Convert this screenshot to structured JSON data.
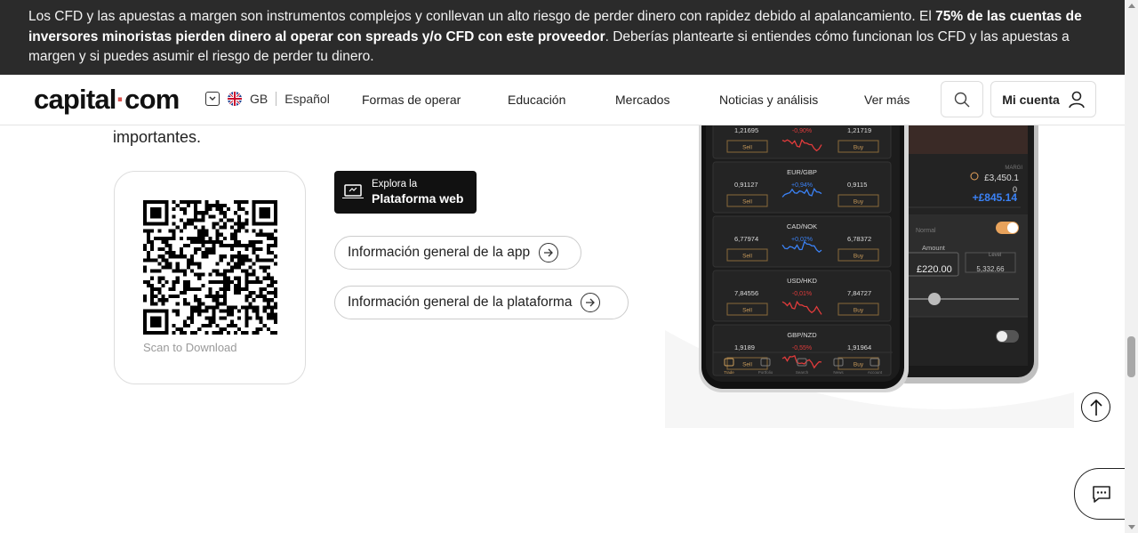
{
  "risk_banner": {
    "part1": "Los CFD y las apuestas a margen son instrumentos complejos y conllevan un alto riesgo de perder dinero con rapidez debido al apalancamiento. El ",
    "bold": "75% de las cuentas de inversores minoristas pierden dinero al operar con spreads y/o CFD con este proveedor",
    "part2": ". Deberías plantearte si entiendes cómo funcionan los CFD y las apuestas a margen y si puedes asumir el riesgo de perder tu dinero."
  },
  "header": {
    "logo_left": "capital",
    "logo_dot": "·",
    "logo_right": "com",
    "region": "GB",
    "language": "Español",
    "nav": [
      "Formas de operar",
      "Educación",
      "Mercados",
      "Noticias y análisis",
      "Ver más"
    ],
    "account_label": "Mi cuenta"
  },
  "main": {
    "intro_tail": "importantes.",
    "qr_caption": "Scan to Download",
    "web_button": {
      "line1": "Explora la",
      "line2": "Plataforma web"
    },
    "links": [
      "Información general de la app",
      "Información general de la plataforma"
    ]
  },
  "phone_app": {
    "markets": [
      {
        "pair": "",
        "sell": "1,21695",
        "change": "-0,90%",
        "buy": "1,21719"
      },
      {
        "pair": "EUR/GBP",
        "sell": "0,91127",
        "change": "+0,94%",
        "buy": "0,9115"
      },
      {
        "pair": "CAD/NOK",
        "sell": "6,77974",
        "change": "+0,02%",
        "buy": "6,78372"
      },
      {
        "pair": "USD/HKD",
        "sell": "7,84556",
        "change": "-0,01%",
        "buy": "7,84727"
      },
      {
        "pair": "GBP/NZD",
        "sell": "1,9189",
        "change": "-0,55%",
        "buy": "1,91964"
      }
    ],
    "sell_label": "Sell",
    "buy_label": "Buy",
    "tabs": [
      "Trade",
      "Portfolio",
      "Search",
      "News",
      "Account"
    ],
    "trade_panel": {
      "margin_label": "MARGI",
      "margin_value": "£3,450.1",
      "zero": "0",
      "pnl": "+£845.14",
      "mode": "Normal",
      "amount_label": "Amount",
      "amount_value": "£220.00",
      "level_label": "Level",
      "level_value": "5,332.66"
    }
  },
  "colors": {
    "banner_bg": "#2b2b2b",
    "positive": "#3b82f6",
    "negative": "#e03b3b",
    "toggle": "#e8a35c"
  },
  "icons": {
    "search": "search-icon",
    "account": "user-icon",
    "to_top": "arrow-up-icon",
    "chat": "chat-icon",
    "chevron": "chevron-down-icon",
    "flag": "uk-flag-icon",
    "arrow": "arrow-right-circle-icon",
    "laptop": "laptop-icon"
  }
}
